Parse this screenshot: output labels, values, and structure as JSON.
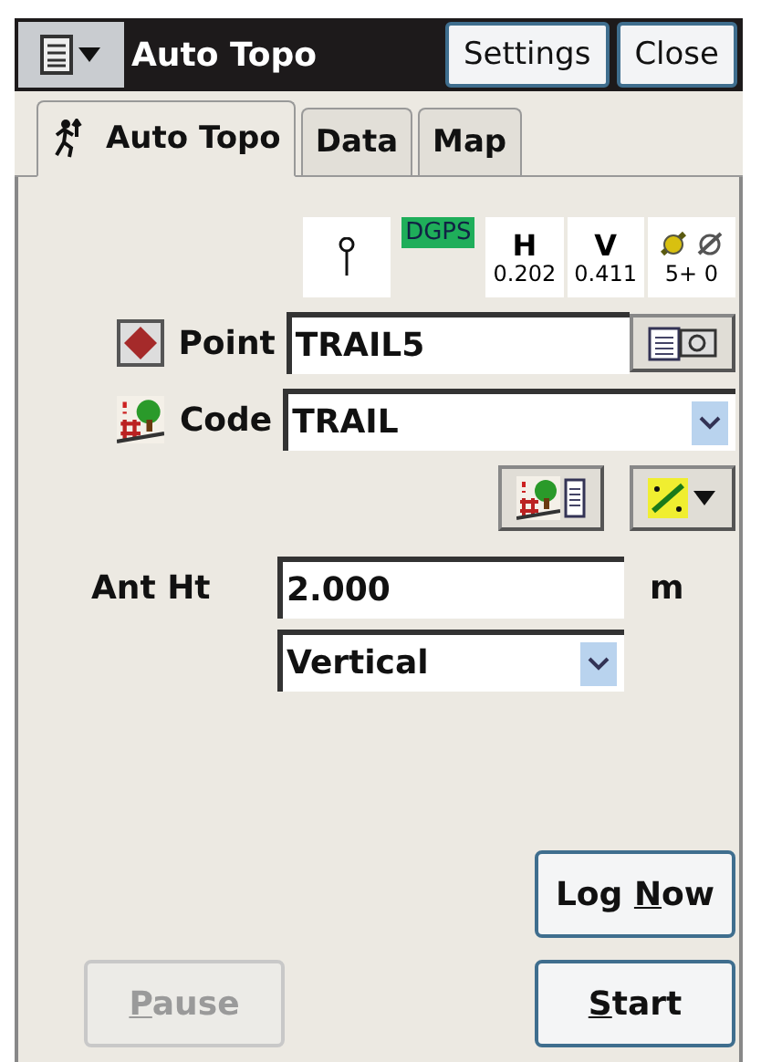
{
  "title_bar": {
    "title": "Auto Topo",
    "buttons": [
      {
        "label": "Settings"
      },
      {
        "label": "Close"
      }
    ]
  },
  "tabs": [
    {
      "label": "Auto Topo",
      "selected": true,
      "kind": "icon"
    },
    {
      "label": "Data",
      "selected": false,
      "kind": "text"
    },
    {
      "label": "Map",
      "selected": false,
      "kind": "text"
    }
  ],
  "status": {
    "solution": "DGPS",
    "h_label": "H",
    "h_value": "0.202",
    "v_label": "V",
    "v_value": "0.411",
    "satellites": "5+ 0"
  },
  "point": {
    "label": "Point",
    "value": "TRAIL5"
  },
  "code": {
    "label": "Code",
    "value": "TRAIL"
  },
  "antenna": {
    "label": "Ant Ht",
    "value": "2.000",
    "unit": "m",
    "method": "Vertical"
  },
  "actions": [
    {
      "before": "Log ",
      "key": "N",
      "after": "ow",
      "disabled": false
    },
    {
      "key": "P",
      "after": "ause",
      "disabled": true
    },
    {
      "key": "S",
      "after": "tart",
      "disabled": false
    }
  ]
}
